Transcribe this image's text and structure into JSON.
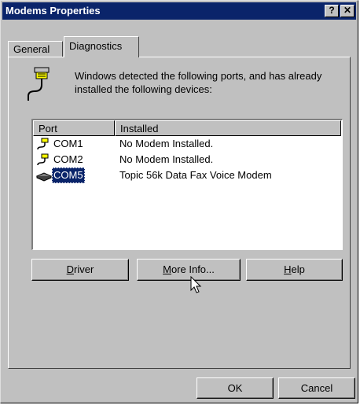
{
  "window": {
    "title": "Modems Properties",
    "help_glyph": "?",
    "close_glyph": "✕"
  },
  "tabs": [
    {
      "label": "General",
      "active": false
    },
    {
      "label": "Diagnostics",
      "active": true
    }
  ],
  "message": "Windows detected the following ports, and has already installed the following devices:",
  "list": {
    "columns": [
      "Port",
      "Installed"
    ],
    "rows": [
      {
        "port": "COM1",
        "installed": "No Modem Installed.",
        "icon": "serial-port-icon",
        "selected": false
      },
      {
        "port": "COM2",
        "installed": "No Modem Installed.",
        "icon": "serial-port-icon",
        "selected": false
      },
      {
        "port": "COM5",
        "installed": "Topic 56k Data Fax Voice Modem",
        "icon": "modem-icon",
        "selected": true
      }
    ]
  },
  "buttons": {
    "driver": {
      "mnemonic": "D",
      "rest": "river"
    },
    "more_info": {
      "mnemonic": "M",
      "rest": "ore Info..."
    },
    "help": {
      "mnemonic": "H",
      "rest": "elp"
    },
    "ok": "OK",
    "cancel": "Cancel"
  },
  "colors": {
    "titlebar": "#0a246a",
    "face": "#c0c0c0",
    "selection": "#0a246a"
  }
}
